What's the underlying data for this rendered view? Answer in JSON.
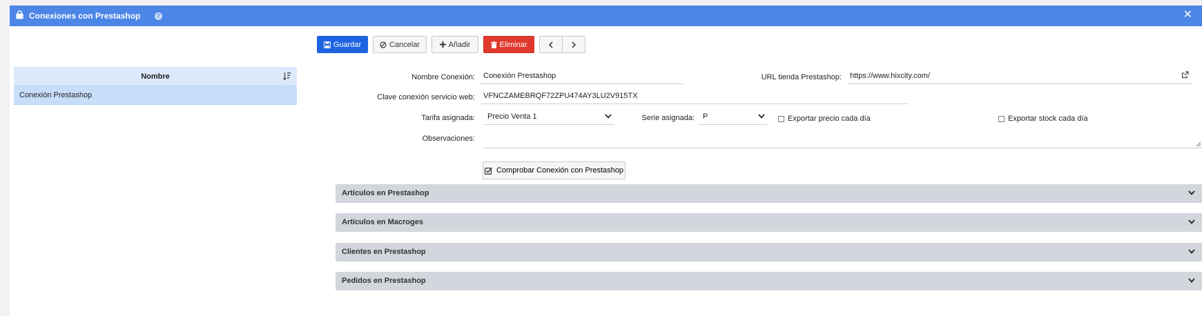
{
  "window": {
    "title": "Conexiones con Prestashop",
    "help_glyph": "?",
    "close_glyph": "✕"
  },
  "toolbar": {
    "save_label": "Guardar",
    "cancel_label": "Cancelar",
    "add_label": "Añadir",
    "delete_label": "Eliminar"
  },
  "list": {
    "header": "Nombre",
    "rows": [
      "Conexión Prestashop"
    ]
  },
  "form": {
    "nombre_label": "Nombre Conexión:",
    "nombre_value": "Conexión Prestashop",
    "url_label": "URL tienda Prestashop:",
    "url_value": "https://www.hixcity.com/",
    "clave_label": "Clave conexión servicio web:",
    "clave_value": "VFNCZAMEBRQF72ZPU474AY3LU2V915TX",
    "tarifa_label": "Tarifa asignada:",
    "tarifa_value": "Precio Venta 1",
    "serie_label": "Serie asignada:",
    "serie_value": "P",
    "exportar_precio_label": "Exportar precio cada día",
    "exportar_stock_label": "Exportar stock cada día",
    "observaciones_label": "Observaciones:",
    "test_button_label": "Comprobar Conexión con Prestashop"
  },
  "panels": [
    "Artículos en Prestashop",
    "Artículos en Macroges",
    "Clientes en Prestashop",
    "Pedidos en Prestashop"
  ],
  "colors": {
    "titlebar": "#4c86e6",
    "primary": "#1f63e0",
    "danger": "#e0392d",
    "panel": "#d3d6dd",
    "list_selected": "#c8ddf9"
  }
}
